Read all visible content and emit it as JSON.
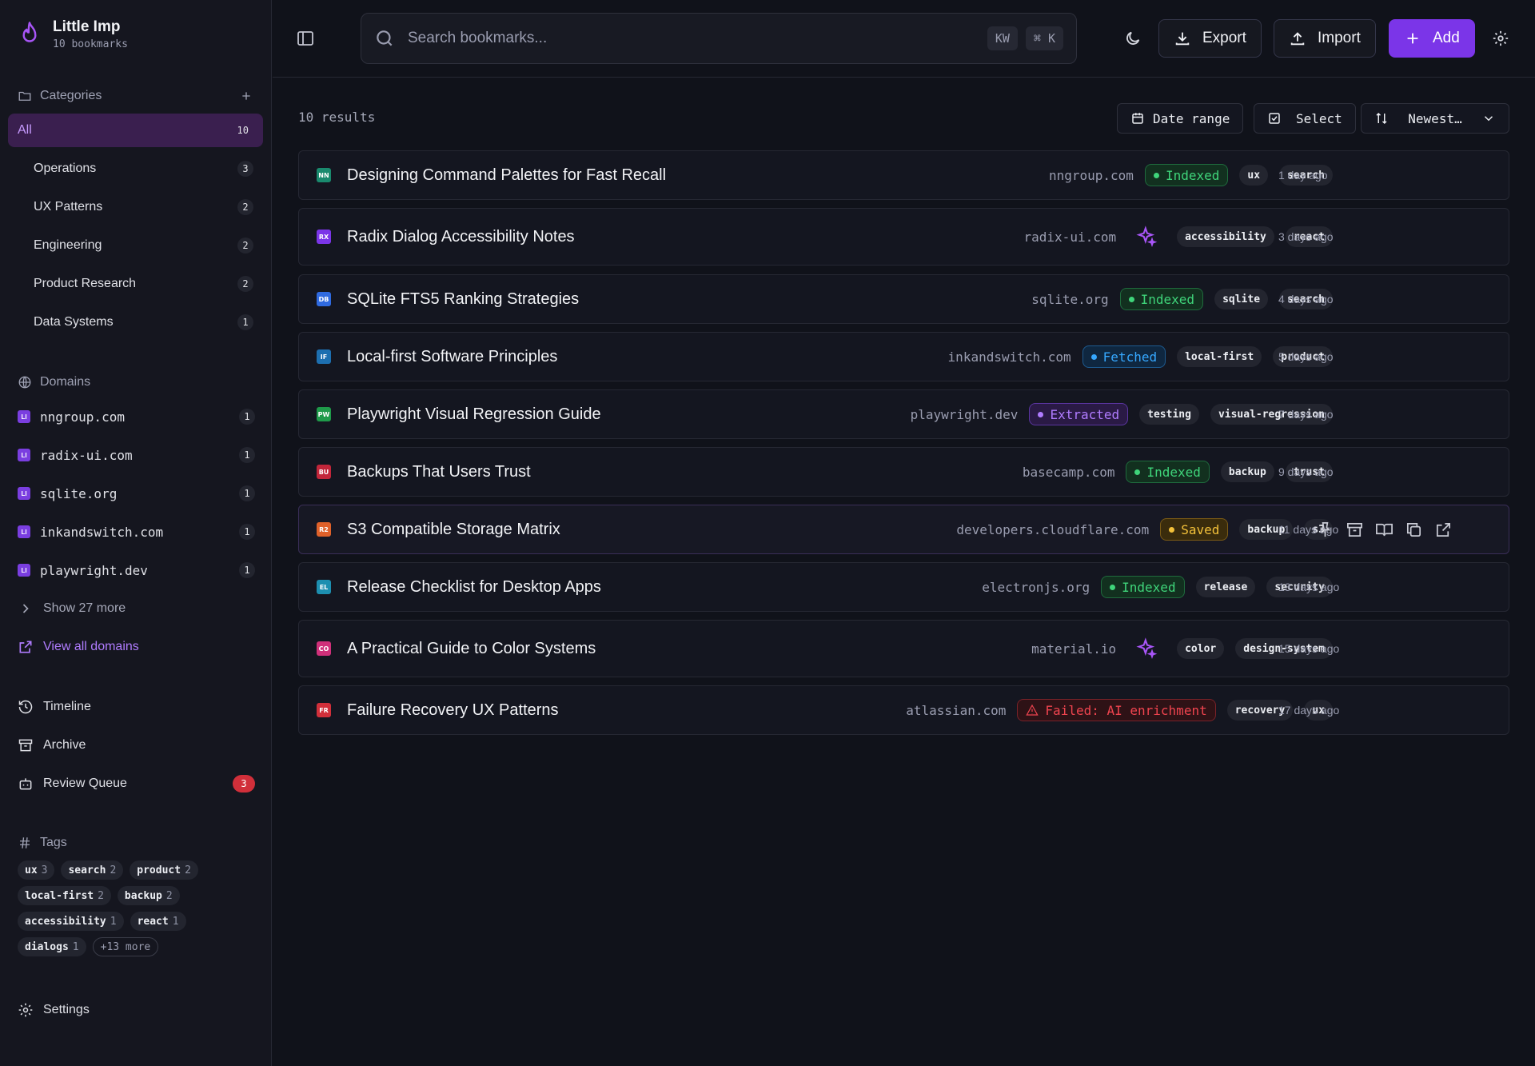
{
  "app": {
    "name": "Little Imp",
    "subtitle": "10 bookmarks"
  },
  "sidebar": {
    "categories_label": "Categories",
    "categories": [
      {
        "label": "All",
        "count": "10"
      },
      {
        "label": "Operations",
        "count": "3"
      },
      {
        "label": "UX Patterns",
        "count": "2"
      },
      {
        "label": "Engineering",
        "count": "2"
      },
      {
        "label": "Product Research",
        "count": "2"
      },
      {
        "label": "Data Systems",
        "count": "1"
      }
    ],
    "domains_label": "Domains",
    "domains": [
      {
        "name": "nngroup.com",
        "count": "1"
      },
      {
        "name": "radix-ui.com",
        "count": "1"
      },
      {
        "name": "sqlite.org",
        "count": "1"
      },
      {
        "name": "inkandswitch.com",
        "count": "1"
      },
      {
        "name": "playwright.dev",
        "count": "1"
      }
    ],
    "domain_icon_text": "LI",
    "show_more": "Show 27 more",
    "view_all": "View all domains",
    "timeline": "Timeline",
    "archive": "Archive",
    "review_queue": "Review Queue",
    "review_count": "3",
    "tags_label": "Tags",
    "tags": [
      {
        "name": "ux",
        "count": "3"
      },
      {
        "name": "search",
        "count": "2"
      },
      {
        "name": "product",
        "count": "2"
      },
      {
        "name": "local-first",
        "count": "2"
      },
      {
        "name": "backup",
        "count": "2"
      },
      {
        "name": "accessibility",
        "count": "1"
      },
      {
        "name": "react",
        "count": "1"
      },
      {
        "name": "dialogs",
        "count": "1"
      }
    ],
    "tags_more": "+13 more",
    "settings": "Settings"
  },
  "search": {
    "placeholder": "Search bookmarks...",
    "kbd1": "KW",
    "kbd2": "⌘ K"
  },
  "topbar": {
    "export": "Export",
    "import": "Import",
    "add": "Add"
  },
  "toolbar": {
    "results": "10 results",
    "date_range": "Date range",
    "select": "Select",
    "sort": "Newest…"
  },
  "bookmarks": [
    {
      "icon": "NN",
      "icon_color": "#1a8a6e",
      "title": "Designing Command Palettes for Fast Recall",
      "domain": "nngroup.com",
      "status": "Indexed",
      "tags": [
        "ux",
        "search"
      ],
      "date": "1 day ago"
    },
    {
      "icon": "RX",
      "icon_color": "#7b35e8",
      "title": "Radix Dialog Accessibility Notes",
      "domain": "radix-ui.com",
      "status": "",
      "tags": [
        "accessibility",
        "react"
      ],
      "date": "3 days ago"
    },
    {
      "icon": "DB",
      "icon_color": "#2f6ae0",
      "title": "SQLite FTS5 Ranking Strategies",
      "domain": "sqlite.org",
      "status": "Indexed",
      "tags": [
        "sqlite",
        "search"
      ],
      "date": "4 days ago"
    },
    {
      "icon": "IF",
      "icon_color": "#1d6fb0",
      "title": "Local-first Software Principles",
      "domain": "inkandswitch.com",
      "status": "Fetched",
      "tags": [
        "local-first",
        "product"
      ],
      "date": "5 days ago"
    },
    {
      "icon": "PW",
      "icon_color": "#1f9a4a",
      "title": "Playwright Visual Regression Guide",
      "domain": "playwright.dev",
      "status": "Extracted",
      "tags": [
        "testing",
        "visual-regression"
      ],
      "date": "7 days ago"
    },
    {
      "icon": "BU",
      "icon_color": "#c2263a",
      "title": "Backups That Users Trust",
      "domain": "basecamp.com",
      "status": "Indexed",
      "tags": [
        "backup",
        "trust"
      ],
      "date": "9 days ago"
    },
    {
      "icon": "R2",
      "icon_color": "#e0612a",
      "title": "S3 Compatible Storage Matrix",
      "domain": "developers.cloudflare.com",
      "status": "Saved",
      "tags": [
        "backup",
        "s3"
      ],
      "date": "11 days ago"
    },
    {
      "icon": "EL",
      "icon_color": "#1d8fb0",
      "title": "Release Checklist for Desktop Apps",
      "domain": "electronjs.org",
      "status": "Indexed",
      "tags": [
        "release",
        "security"
      ],
      "date": "13 days ago"
    },
    {
      "icon": "CO",
      "icon_color": "#d0307a",
      "title": "A Practical Guide to Color Systems",
      "domain": "material.io",
      "status": "",
      "tags": [
        "color",
        "design-system"
      ],
      "date": "15 days ago"
    },
    {
      "icon": "FR",
      "icon_color": "#d12f3a",
      "title": "Failure Recovery UX Patterns",
      "domain": "atlassian.com",
      "status": "Failed: AI enrichment",
      "tags": [
        "recovery",
        "ux"
      ],
      "date": "17 days ago"
    }
  ],
  "colors": {
    "accent": "#7b35e8",
    "background": "#10121a",
    "sidebar": "#15161f"
  }
}
